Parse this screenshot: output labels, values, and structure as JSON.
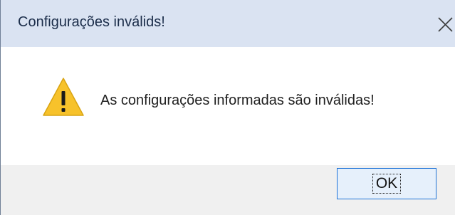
{
  "dialog": {
    "title": "Configurações inválids!",
    "message": "As configurações informadas são inválidas!",
    "ok_label": "OK",
    "close_icon": "close-icon",
    "warning_icon": "warning-icon"
  },
  "colors": {
    "titlebar_bg": "#dae3f2",
    "content_bg": "#ffffff",
    "footer_bg": "#f0f0f0",
    "warning_yellow": "#f7c22b",
    "button_border": "#1e73d8",
    "button_bg": "#e6f0fb"
  }
}
